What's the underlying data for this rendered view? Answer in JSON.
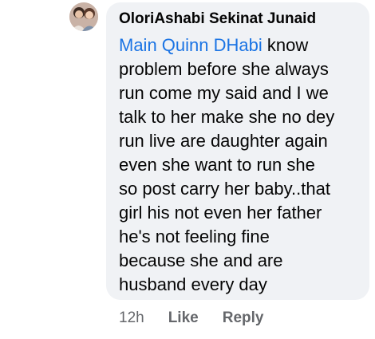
{
  "comment": {
    "avatar_icon": "profile-photo",
    "author": "OloriAshabi Sekinat Junaid",
    "mention": "Main Quinn DHabi",
    "body_lines": [
      " know",
      "problem before she always",
      "run come my said and I we",
      "talk to her make she no dey",
      "run live are daughter again",
      "even she want to run she",
      "so post carry her baby..that",
      "girl his not even her father",
      "he's not feeling fine",
      "because she and  are",
      "husband every day"
    ],
    "timestamp": "12h",
    "like_label": "Like",
    "reply_label": "Reply",
    "colors": {
      "bubble_bg": "#f0f2f5",
      "mention": "#1b74e4",
      "meta_text": "#65676b"
    }
  }
}
